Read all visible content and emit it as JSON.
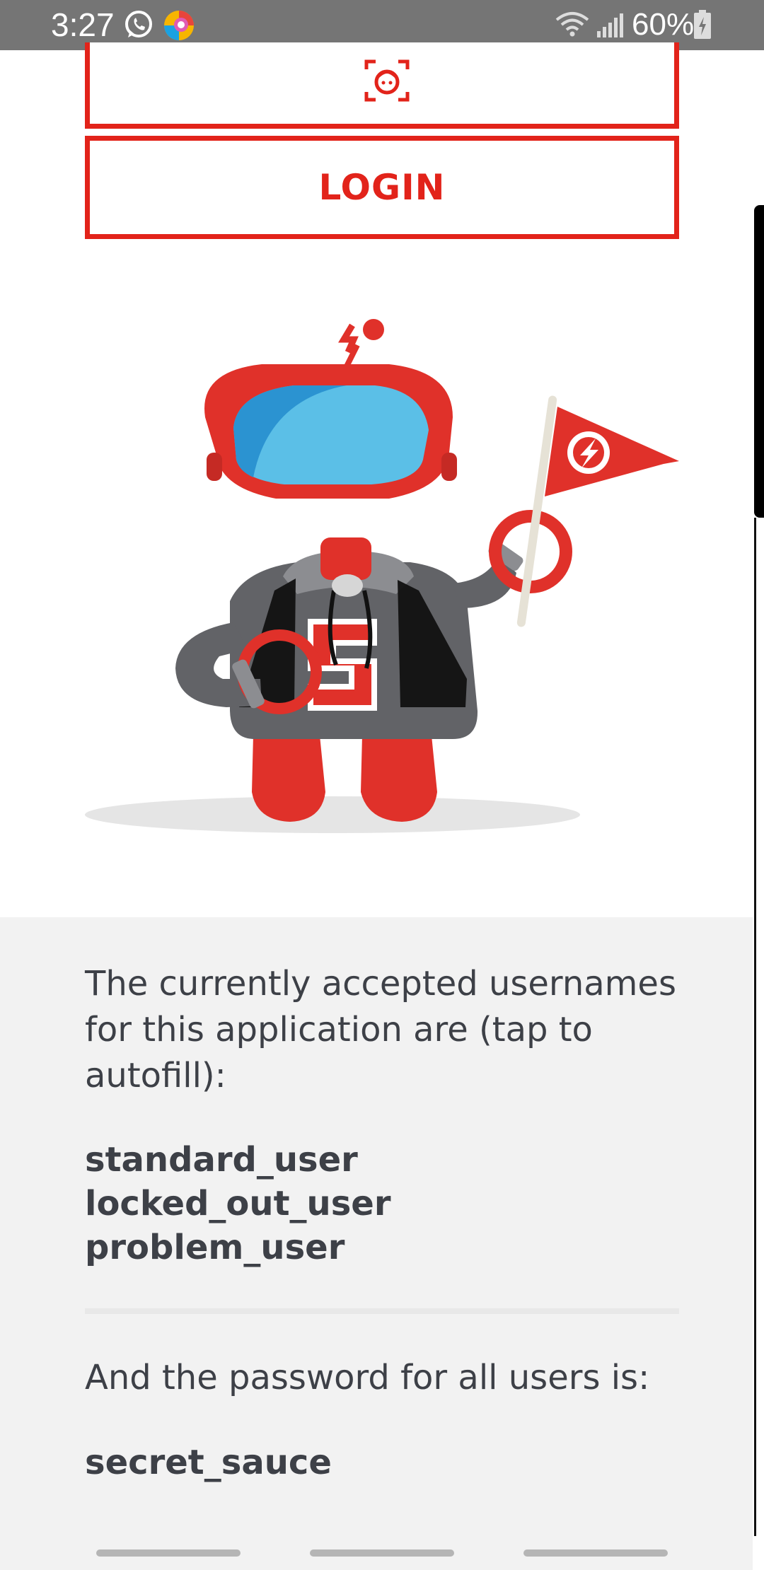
{
  "status_bar": {
    "time": "3:27",
    "battery": "60%",
    "icons": [
      "whatsapp-icon",
      "app-icon",
      "wifi-icon",
      "signal-icon",
      "battery-icon"
    ]
  },
  "buttons": {
    "biometry_icon": "face-scan-icon",
    "login_label": "LOGIN"
  },
  "illustration": {
    "name": "robot-mascot-with-flag"
  },
  "info": {
    "accepted_text": "The currently accepted usernames for this application are (tap to autofill):",
    "usernames": [
      "standard_user",
      "locked_out_user",
      "problem_user"
    ],
    "password_label": "And the password for all users is:",
    "password": "secret_sauce"
  },
  "colors": {
    "brand_red": "#e2231a",
    "status_bar": "#757575",
    "info_bg": "#f2f2f2",
    "text": "#3d4047"
  }
}
